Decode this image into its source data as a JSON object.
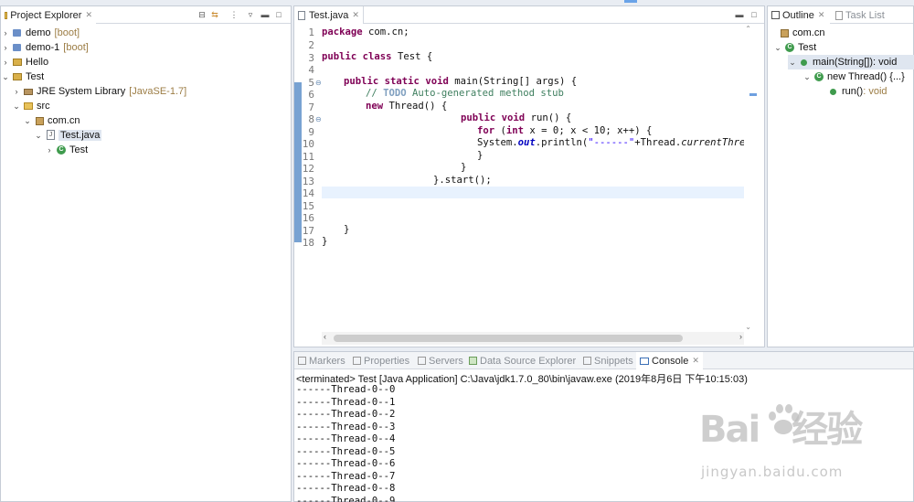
{
  "project_explorer": {
    "tab_label": "Project Explorer",
    "items": [
      {
        "label": "demo",
        "decoration": "[boot]"
      },
      {
        "label": "demo-1",
        "decoration": "[boot]"
      },
      {
        "label": "Hello",
        "decoration": ""
      },
      {
        "label": "Test",
        "decoration": ""
      },
      {
        "label": "JRE System Library",
        "decoration": "[JavaSE-1.7]"
      },
      {
        "label": "src",
        "decoration": ""
      },
      {
        "label": "com.cn",
        "decoration": ""
      },
      {
        "label": "Test.java",
        "decoration": ""
      },
      {
        "label": "Test",
        "decoration": ""
      }
    ]
  },
  "editor": {
    "tab_label": "Test.java",
    "line_numbers": [
      "1",
      "2",
      "3",
      "4",
      "5",
      "6",
      "7",
      "8",
      "9",
      "10",
      "11",
      "12",
      "13",
      "14",
      "15",
      "16",
      "17",
      "18"
    ],
    "code": {
      "l1_kw": "package",
      "l1_rest": " com.cn;",
      "l3_kw1": "public",
      "l3_kw2": "class",
      "l3_rest": " Test {",
      "l5_kw1": "public",
      "l5_kw2": "static",
      "l5_kw3": "void",
      "l5_rest": " main(String[] args) {",
      "l6_c1": "// ",
      "l6_todo": "TODO",
      "l6_c2": " Auto-generated method stub",
      "l7_kw": "new",
      "l7_rest": " Thread() {",
      "l8_kw1": "public",
      "l8_kw2": "void",
      "l8_rest": " run() {",
      "l9_kw1": "for",
      "l9_p1": " (",
      "l9_kw2": "int",
      "l9_rest": " x = 0; x < 10; x++) {",
      "l10_a": "System.",
      "l10_out": "out",
      "l10_b": ".println(",
      "l10_str": "\"------\"",
      "l10_c": "+Thread.",
      "l10_it": "currentThread",
      "l11": "}",
      "l12": "}",
      "l13": "}.start();",
      "l17": "}",
      "l18": "}"
    }
  },
  "outline": {
    "tab_label": "Outline",
    "tasklist_label": "Task List",
    "items": [
      {
        "label": "com.cn",
        "suffix": ""
      },
      {
        "label": "Test",
        "suffix": ""
      },
      {
        "label": "main(String[])",
        "suffix": " : void"
      },
      {
        "label": "new Thread() {...}",
        "suffix": ""
      },
      {
        "label": "run()",
        "suffix": " : void"
      }
    ]
  },
  "bottom_tabs": [
    "Markers",
    "Properties",
    "Servers",
    "Data Source Explorer",
    "Snippets",
    "Console"
  ],
  "console": {
    "header": "<terminated> Test [Java Application] C:\\Java\\jdk1.7.0_80\\bin\\javaw.exe (2019年8月6日 下午10:15:03)",
    "lines": [
      "------Thread-0--0",
      "------Thread-0--1",
      "------Thread-0--2",
      "------Thread-0--3",
      "------Thread-0--4",
      "------Thread-0--5",
      "------Thread-0--6",
      "------Thread-0--7",
      "------Thread-0--8",
      "------Thread-0--9"
    ]
  },
  "watermark": {
    "logo": "Bai  经验",
    "url": "jingyan.baidu.com"
  },
  "colors": {
    "keyword": "#7f0055",
    "comment": "#3f7f5f",
    "string": "#2a00ff",
    "field": "#0000c0",
    "current_line": "#e8f2fe",
    "selection": "#dfe6f0"
  }
}
